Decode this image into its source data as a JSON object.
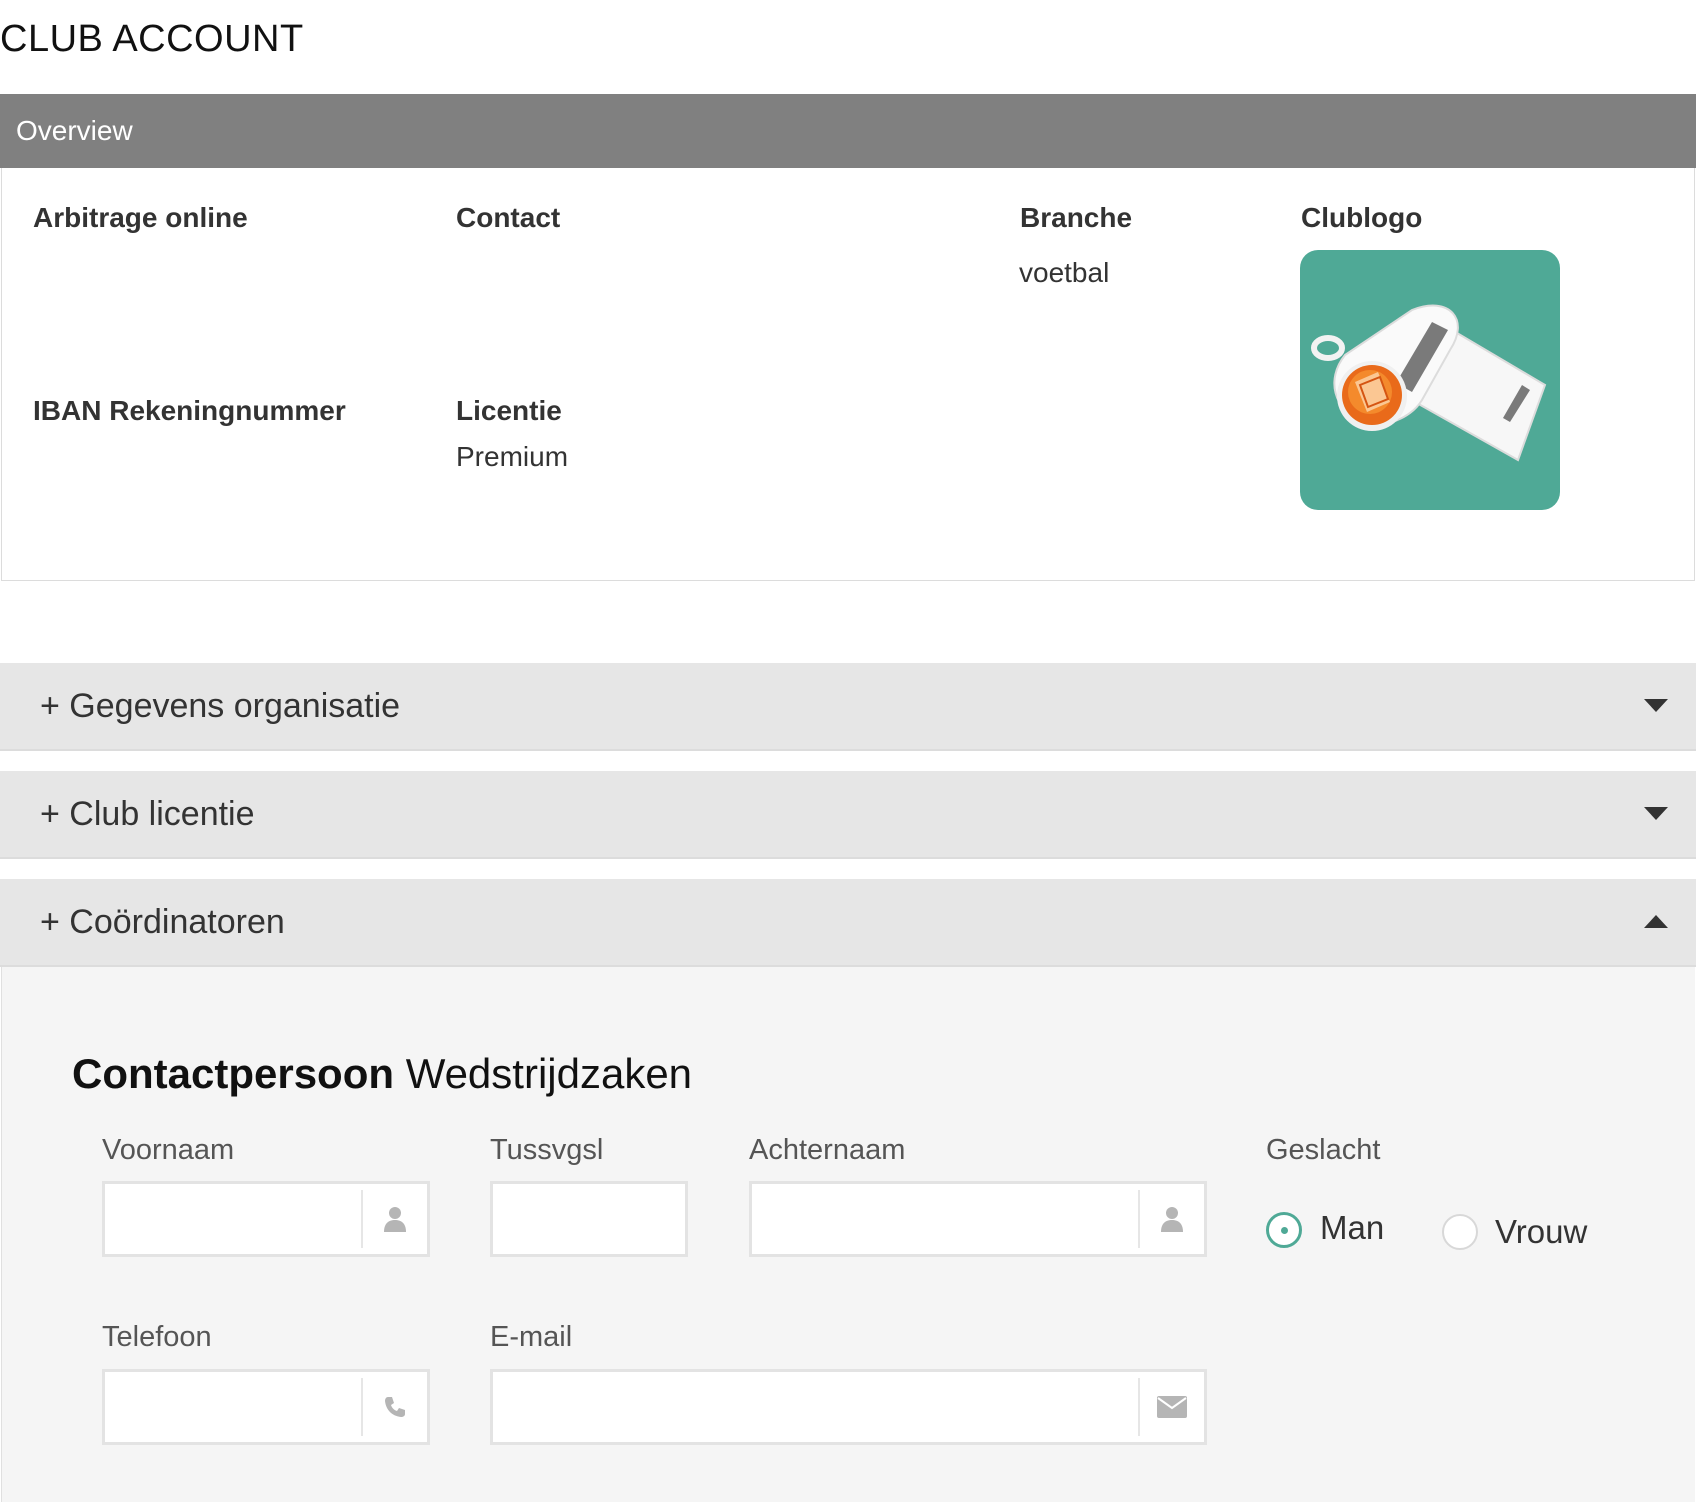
{
  "page_title": "CLUB ACCOUNT",
  "overview": {
    "header": "Overview",
    "arbitrage_label": "Arbitrage online",
    "contact_label": "Contact",
    "branche_label": "Branche",
    "branche_value": "voetbal",
    "clublogo_label": "Clublogo",
    "iban_label": "IBAN Rekeningnummer",
    "licentie_label": "Licentie",
    "licentie_value": "Premium"
  },
  "accordions": [
    {
      "title": "+ Gegevens organisatie",
      "state": "collapsed"
    },
    {
      "title": "+ Club licentie",
      "state": "collapsed"
    },
    {
      "title": "+ Coördinatoren",
      "state": "expanded"
    }
  ],
  "coordinator_form": {
    "heading_bold": "Contactpersoon",
    "heading_rest": "Wedstrijdzaken",
    "fields": {
      "voornaam": {
        "label": "Voornaam",
        "value": "",
        "icon": "user-icon"
      },
      "tussvgsl": {
        "label": "Tussvgsl",
        "value": ""
      },
      "achternaam": {
        "label": "Achternaam",
        "value": "",
        "icon": "user-icon"
      },
      "telefoon": {
        "label": "Telefoon",
        "value": "",
        "icon": "phone-icon"
      },
      "email": {
        "label": "E-mail",
        "value": "",
        "icon": "envelope-icon"
      }
    },
    "geslacht": {
      "label": "Geslacht",
      "options": [
        "Man",
        "Vrouw"
      ],
      "selected": "Man"
    }
  },
  "colors": {
    "overview_header": "#808080",
    "accordion_bg": "#e6e6e6",
    "accent": "#4fa996",
    "panel_bg": "#f5f5f5"
  }
}
